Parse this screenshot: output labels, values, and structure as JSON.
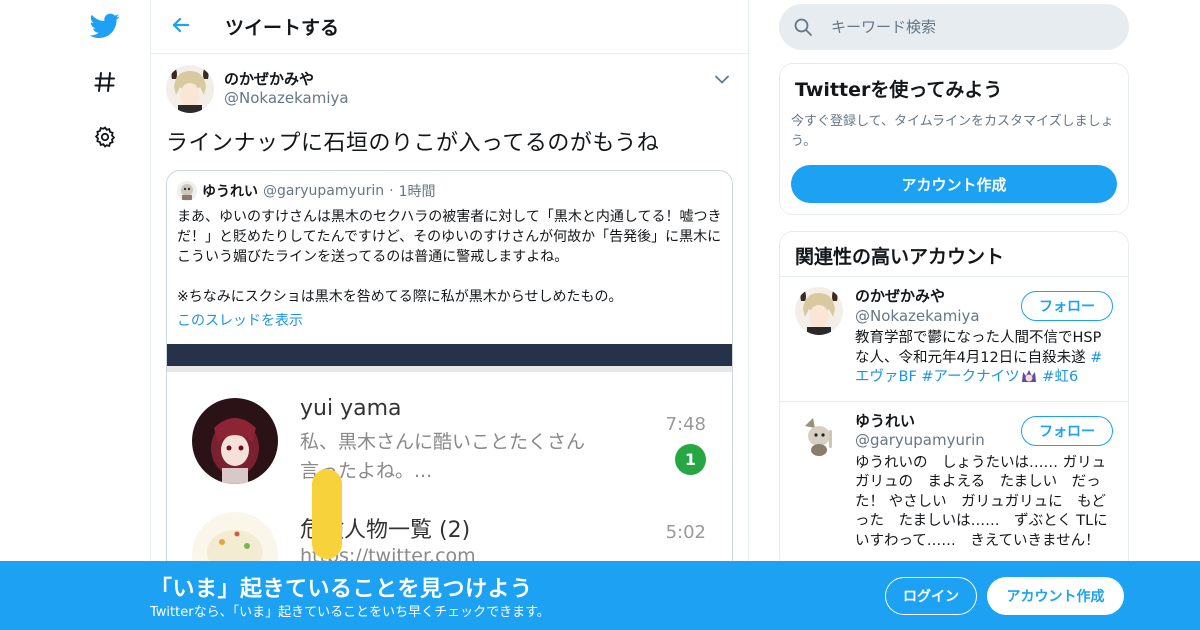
{
  "colors": {
    "accent": "#1da1f2",
    "link": "#1b95e0",
    "secondary_text": "#657786",
    "border": "#e6ecf0",
    "badge_green": "#27a744"
  },
  "nav": {
    "items": [
      {
        "icon": "twitter-bird-icon"
      },
      {
        "icon": "hashtag-icon"
      },
      {
        "icon": "gear-icon"
      }
    ]
  },
  "header": {
    "back_icon": "back-arrow-icon",
    "title": "ツイートする"
  },
  "tweet": {
    "author_name": "のかぜかみや",
    "author_handle": "@Nokazekamiya",
    "menu_icon": "chevron-down-icon",
    "text": "ラインナップに石垣のりこが入ってるのがもうね",
    "quote": {
      "author_name": "ゆうれい",
      "author_handle": "@garyupamyurin",
      "separator": "·",
      "time": "1時間",
      "text_p1": "まあ、ゆいのすけさんは黒木のセクハラの被害者に対して「黒木と内通してる！嘘つきだ！」と貶めたりしてたんですけど、そのゆいのすけさんが何故か「告発後」に黒木にこういう媚びたラインを送ってるのは普通に警戒しますよね。",
      "text_p2": "※ちなみにスクショは黒木を咎めてる際に私が黒木からせしめたもの。",
      "thread_link": "このスレッドを表示",
      "image": {
        "chat1_name": "yui yama",
        "chat1_msg": "私、黒木さんに酷いことたくさん言ったよね。...",
        "chat1_time": "7:48",
        "chat1_badge": "1",
        "chat2_name": "危険人物一覧 (2)",
        "chat2_msg": "https://twitter.com",
        "chat2_time": "5:02"
      }
    }
  },
  "search": {
    "icon": "search-icon",
    "placeholder": "キーワード検索"
  },
  "signup_card": {
    "title": "Twitterを使ってみよう",
    "description": "今すぐ登録して、タイムラインをカスタマイズしましょう。",
    "button": "アカウント作成"
  },
  "related": {
    "title": "関連性の高いアカウント",
    "accounts": [
      {
        "name": "のかぜかみや",
        "handle": "@Nokazekamiya",
        "follow": "フォロー",
        "bio_text": "教育学部で鬱になった人間不信でHSPな人、令和元年4月12日に自殺未遂 ",
        "bio_tag1": "#エヴァBF",
        "bio_tag2": "#アークナイツ",
        "bio_tag3": "#虹6"
      },
      {
        "name": "ゆうれい",
        "handle": "@garyupamyurin",
        "follow": "フォロー",
        "bio_text": "ゆうれいの　しょうたいは…… ガリュガリュの　まよえる　たましい　だった！ やさしい　ガリュガリュに　もどった　たましいは……　ずぶとく TLにいすわって……　きえていきません！"
      }
    ]
  },
  "bottom_bar": {
    "title": "「いま」起きていることを見つけよう",
    "subtitle": "Twitterなら、「いま」起きていることをいち早くチェックできます。",
    "login": "ログイン",
    "signup": "アカウント作成"
  }
}
